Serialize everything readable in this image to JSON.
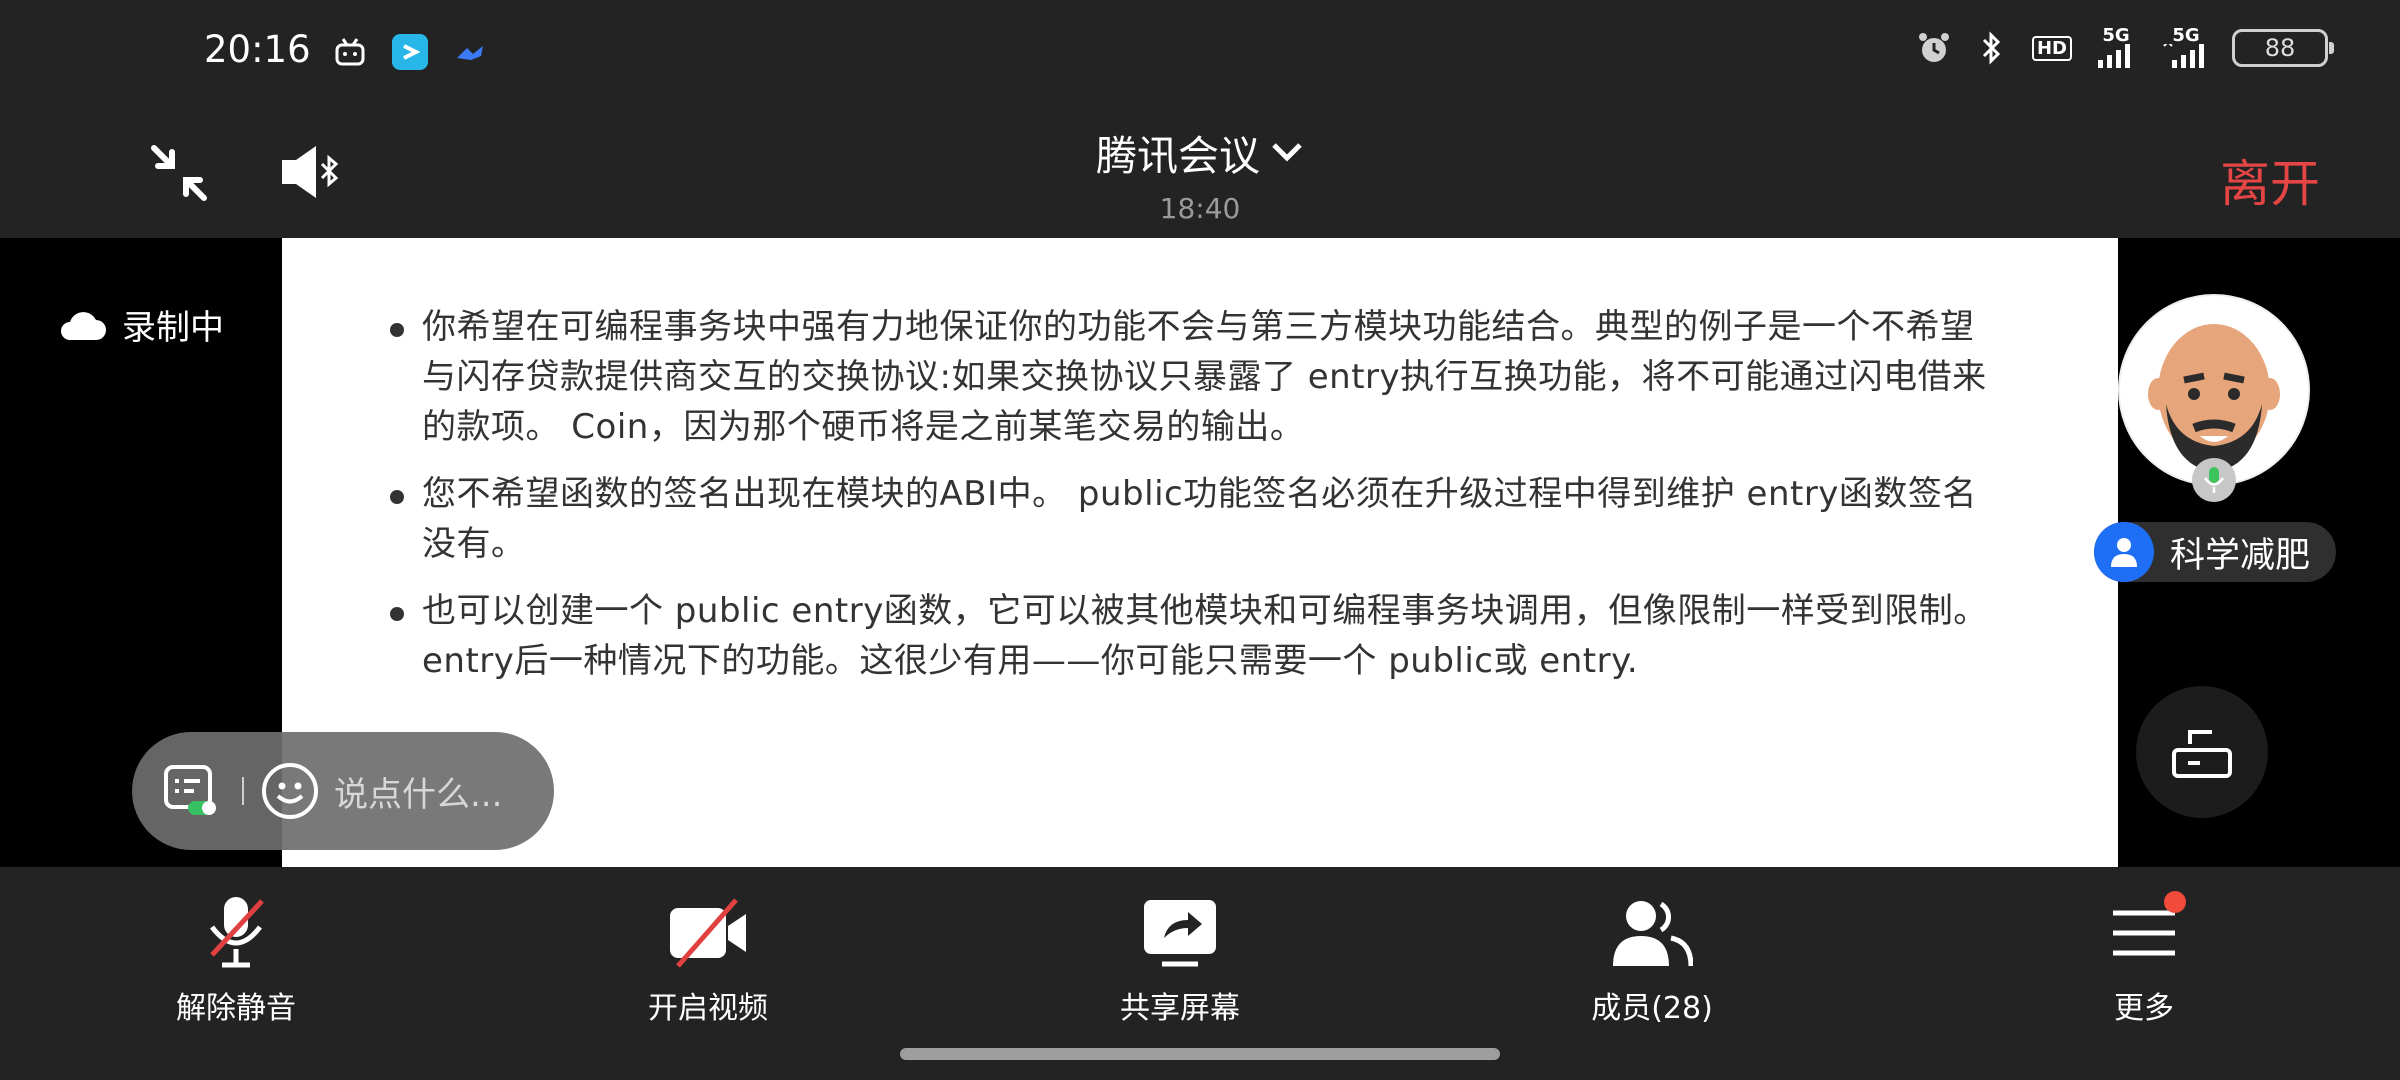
{
  "status_bar": {
    "time": "20:16",
    "signal_1": "5G",
    "signal_2": "5G",
    "hd_label": "HD",
    "battery": "88"
  },
  "header": {
    "title": "腾讯会议",
    "elapsed": "18:40",
    "leave_label": "离开"
  },
  "recording": {
    "label": "录制中"
  },
  "slide": {
    "bullets": [
      "你希望在可编程事务块中强有力地保证你的功能不会与第三方模块功能结合。典型的例子是一个不希望与闪存贷款提供商交互的交换协议:如果交换协议只暴露了 entry执行互换功能，将不可能通过闪电借来的款项。 Coin，因为那个硬币将是之前某笔交易的输出。",
      "您不希望函数的签名出现在模块的ABI中。 public功能签名必须在升级过程中得到维护 entry函数签名没有。",
      "也可以创建一个 public entry函数，它可以被其他模块和可编程事务块调用，但像限制一样受到限制。 entry后一种情况下的功能。这很少有用——你可能只需要一个 public或 entry."
    ]
  },
  "chat": {
    "placeholder": "说点什么..."
  },
  "participant": {
    "name": "科学减肥"
  },
  "toolbar": {
    "unmute": "解除静音",
    "video": "开启视频",
    "share": "共享屏幕",
    "members": "成员(28)",
    "more": "更多"
  },
  "colors": {
    "leave": "#e64545",
    "name_tag_icon": "#1e6ff5",
    "mute_slash": "#e04040",
    "notification_dot": "#f24a3b"
  }
}
